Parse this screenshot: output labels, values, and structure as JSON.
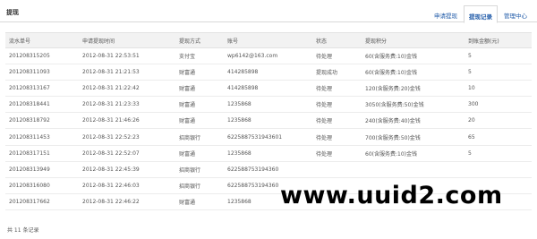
{
  "header": {
    "title": "提现",
    "tabs": [
      {
        "label": "申请提现",
        "active": false
      },
      {
        "label": "提现记录",
        "active": true
      },
      {
        "label": "管理中心",
        "active": false
      }
    ]
  },
  "table": {
    "columns": [
      "流水单号",
      "申请提现时间",
      "提现方式",
      "账号",
      "状态",
      "提现积分",
      "到账金额(元)"
    ],
    "rows": [
      [
        "201208315205",
        "2012-08-31 22:53:51",
        "支付宝",
        "wp6142@163.com",
        "待处理",
        "60(含服务费:10)金钱",
        "5"
      ],
      [
        "201208311093",
        "2012-08-31 21:21:53",
        "财富通",
        "414285898",
        "提现成功",
        "60(含服务费:10)金钱",
        "5"
      ],
      [
        "201208313167",
        "2012-08-31 21:22:42",
        "财富通",
        "414285898",
        "待处理",
        "120(含服务费:20)金钱",
        "10"
      ],
      [
        "201208318441",
        "2012-08-31 21:23:33",
        "财富通",
        "1235868",
        "待处理",
        "3050(含服务费:50)金钱",
        "300"
      ],
      [
        "201208318792",
        "2012-08-31 21:46:26",
        "财富通",
        "1235868",
        "待处理",
        "240(含服务费:40)金钱",
        "20"
      ],
      [
        "201208311453",
        "2012-08-31 22:52:23",
        "招商银行",
        "6225887531943601",
        "待处理",
        "700(含服务费:50)金钱",
        "65"
      ],
      [
        "201208317151",
        "2012-08-31 22:52:07",
        "财富通",
        "1235868",
        "待处理",
        "60(含服务费:10)金钱",
        "5"
      ],
      [
        "201208313949",
        "2012-08-31 22:45:39",
        "招商银行",
        "622588753194360",
        "",
        "",
        ""
      ],
      [
        "201208316080",
        "2012-08-31 22:46:03",
        "招商银行",
        "622588753194360",
        "",
        "",
        ""
      ],
      [
        "201208317662",
        "2012-08-31 22:46:22",
        "财富通",
        "1235868",
        "",
        "",
        ""
      ]
    ]
  },
  "footer": {
    "count_text": "共 11 条记录"
  },
  "watermark": {
    "text": "www.uuid2.com"
  }
}
